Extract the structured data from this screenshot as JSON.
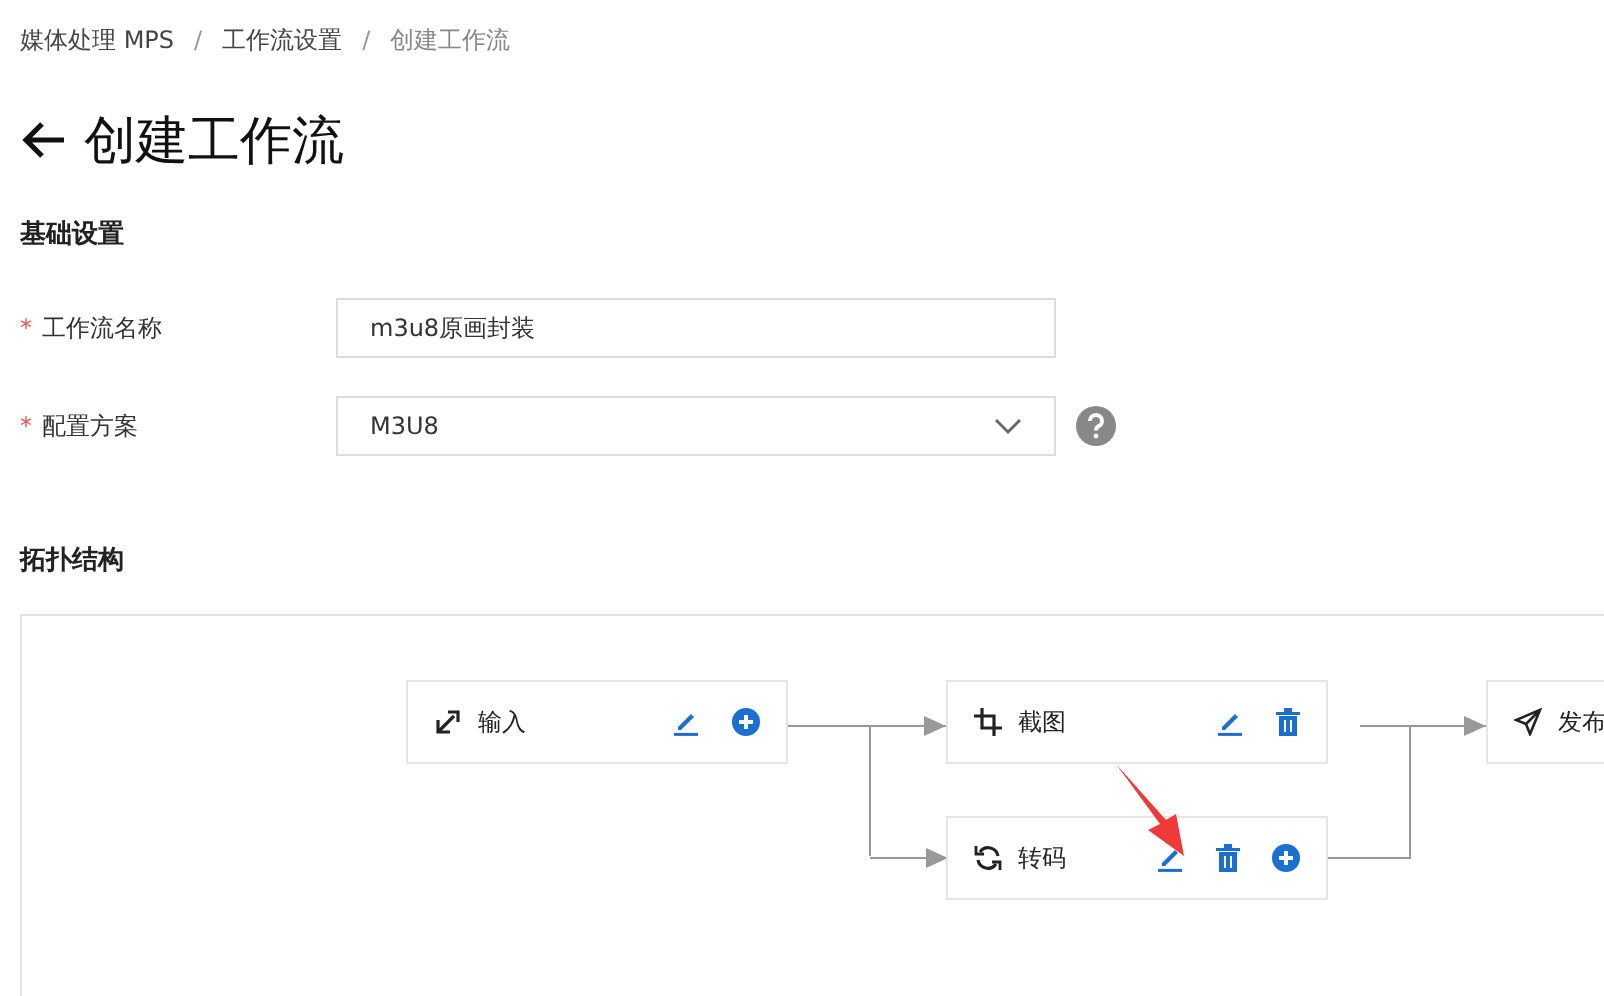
{
  "breadcrumb": {
    "separator": "/",
    "items": [
      "媒体处理 MPS",
      "工作流设置",
      "创建工作流"
    ]
  },
  "title": "创建工作流",
  "basic_section": {
    "heading": "基础设置",
    "fields": [
      {
        "kind": "text",
        "label": "工作流名称",
        "required_mark": "*",
        "value": "m3u8原画封装"
      },
      {
        "kind": "select",
        "label": "配置方案",
        "required_mark": "*",
        "value": "M3U8"
      }
    ]
  },
  "topology": {
    "heading": "拓扑结构",
    "nodes": [
      {
        "kind": "input",
        "label": "输入",
        "actions": [
          {
            "kind": "edit"
          },
          {
            "kind": "add"
          }
        ]
      },
      {
        "kind": "snapshot",
        "label": "截图",
        "actions": [
          {
            "kind": "edit"
          },
          {
            "kind": "delete"
          }
        ]
      },
      {
        "kind": "transcode",
        "label": "转码",
        "actions": [
          {
            "kind": "edit"
          },
          {
            "kind": "delete"
          },
          {
            "kind": "add"
          }
        ]
      },
      {
        "kind": "publish",
        "label": "发布"
      }
    ]
  }
}
